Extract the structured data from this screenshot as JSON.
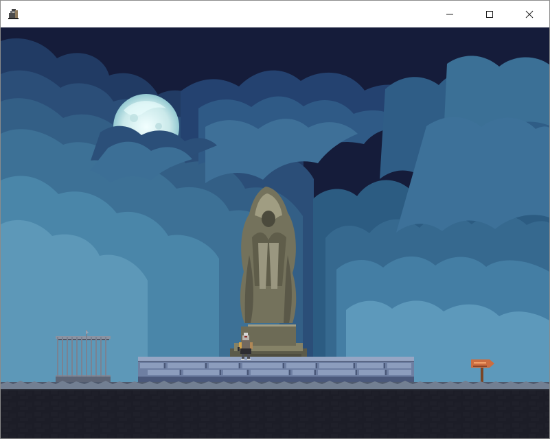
{
  "window": {
    "title": "",
    "app_icon": "cloaked-knight-app-icon",
    "controls": {
      "minimize_icon": "minimize-icon",
      "maximize_icon": "maximize-icon",
      "close_icon": "close-icon"
    }
  },
  "scene": {
    "background": "night-sky",
    "moon": "full-moon",
    "statue": "hooded-praying-statue",
    "player": "armored-knight",
    "gate": "iron-gate",
    "sign": "wooden-arrow-sign",
    "colors": {
      "sky": "#151c3a",
      "cloud_dark": "#243e67",
      "cloud_mid": "#34658a",
      "cloud_light": "#4f8fb0",
      "moon": "#d6f0ef",
      "stone_statue": "#6f6d57",
      "stone_platform": "#7d8eac",
      "ground": "#1d1f2a",
      "grass": "#5e6a7c",
      "sign": "#c86b3e"
    }
  }
}
